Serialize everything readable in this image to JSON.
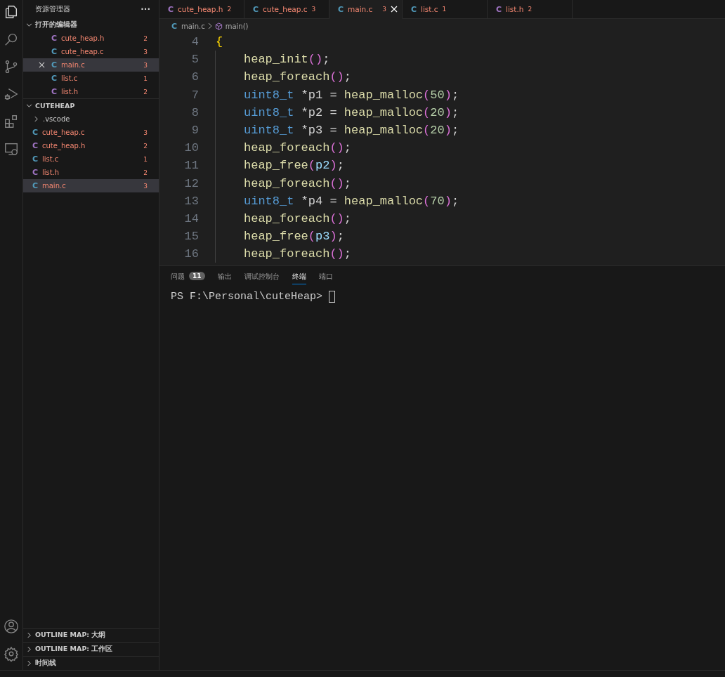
{
  "sidebar": {
    "title": "资源管理器",
    "more": "···",
    "open_editors": {
      "title": "打开的编辑器",
      "expanded": true,
      "items": [
        {
          "icon": "C",
          "kind": "header",
          "name": "cute_heap.h",
          "count": "2",
          "selected": false
        },
        {
          "icon": "C",
          "kind": "source",
          "name": "cute_heap.c",
          "count": "3",
          "selected": false
        },
        {
          "icon": "C",
          "kind": "source",
          "name": "main.c",
          "count": "3",
          "selected": true
        },
        {
          "icon": "C",
          "kind": "source",
          "name": "list.c",
          "count": "1",
          "selected": false
        },
        {
          "icon": "C",
          "kind": "header",
          "name": "list.h",
          "count": "2",
          "selected": false
        }
      ]
    },
    "folder": {
      "title": "CUTEHEAP",
      "expanded": true,
      "items": [
        {
          "kind": "folder",
          "name": ".vscode",
          "expanded": false,
          "selected": false
        },
        {
          "kind": "source",
          "icon": "C",
          "name": "cute_heap.c",
          "count": "3",
          "selected": false
        },
        {
          "kind": "header",
          "icon": "C",
          "name": "cute_heap.h",
          "count": "2",
          "selected": false
        },
        {
          "kind": "source",
          "icon": "C",
          "name": "list.c",
          "count": "1",
          "selected": false
        },
        {
          "kind": "header",
          "icon": "C",
          "name": "list.h",
          "count": "2",
          "selected": false
        },
        {
          "kind": "source",
          "icon": "C",
          "name": "main.c",
          "count": "3",
          "selected": true
        }
      ]
    },
    "bottom_sections": [
      {
        "title": "OUTLINE MAP: 大纲",
        "expanded": false
      },
      {
        "title": "OUTLINE MAP: 工作区",
        "expanded": false
      },
      {
        "title": "时间线",
        "expanded": false
      }
    ]
  },
  "tabs": [
    {
      "icon": "C",
      "kind": "header",
      "name": "cute_heap.h",
      "count": "2",
      "selected": false
    },
    {
      "icon": "C",
      "kind": "source",
      "name": "cute_heap.c",
      "count": "3",
      "selected": false
    },
    {
      "icon": "C",
      "kind": "source",
      "name": "main.c",
      "count": "3",
      "selected": true
    },
    {
      "icon": "C",
      "kind": "source",
      "name": "list.c",
      "count": "1",
      "selected": false
    },
    {
      "icon": "C",
      "kind": "header",
      "name": "list.h",
      "count": "2",
      "selected": false
    }
  ],
  "breadcrumb": {
    "icon": "C",
    "file": "main.c",
    "symbol": "main()"
  },
  "code": [
    {
      "number": "4",
      "indent": false,
      "tokens": [
        {
          "kind": "brace",
          "text": "{"
        }
      ]
    },
    {
      "number": "5",
      "indent": true,
      "tokens": [
        {
          "kind": "fn",
          "text": "heap_init"
        },
        {
          "kind": "paren",
          "text": "()"
        },
        {
          "kind": "plain",
          "text": ";"
        }
      ]
    },
    {
      "number": "6",
      "indent": true,
      "tokens": [
        {
          "kind": "fn",
          "text": "heap_foreach"
        },
        {
          "kind": "paren",
          "text": "()"
        },
        {
          "kind": "plain",
          "text": ";"
        }
      ]
    },
    {
      "number": "7",
      "indent": true,
      "tokens": [
        {
          "kind": "type",
          "text": "uint8_t"
        },
        {
          "kind": "plain",
          "text": " *p1 = "
        },
        {
          "kind": "fn",
          "text": "heap_malloc"
        },
        {
          "kind": "paren",
          "text": "("
        },
        {
          "kind": "num",
          "text": "50"
        },
        {
          "kind": "paren",
          "text": ")"
        },
        {
          "kind": "plain",
          "text": ";"
        }
      ]
    },
    {
      "number": "8",
      "indent": true,
      "tokens": [
        {
          "kind": "type",
          "text": "uint8_t"
        },
        {
          "kind": "plain",
          "text": " *p2 = "
        },
        {
          "kind": "fn",
          "text": "heap_malloc"
        },
        {
          "kind": "paren",
          "text": "("
        },
        {
          "kind": "num",
          "text": "20"
        },
        {
          "kind": "paren",
          "text": ")"
        },
        {
          "kind": "plain",
          "text": ";"
        }
      ]
    },
    {
      "number": "9",
      "indent": true,
      "tokens": [
        {
          "kind": "type",
          "text": "uint8_t"
        },
        {
          "kind": "plain",
          "text": " *p3 = "
        },
        {
          "kind": "fn",
          "text": "heap_malloc"
        },
        {
          "kind": "paren",
          "text": "("
        },
        {
          "kind": "num",
          "text": "20"
        },
        {
          "kind": "paren",
          "text": ")"
        },
        {
          "kind": "plain",
          "text": ";"
        }
      ]
    },
    {
      "number": "10",
      "indent": true,
      "tokens": [
        {
          "kind": "fn",
          "text": "heap_foreach"
        },
        {
          "kind": "paren",
          "text": "()"
        },
        {
          "kind": "plain",
          "text": ";"
        }
      ]
    },
    {
      "number": "11",
      "indent": true,
      "tokens": [
        {
          "kind": "fn",
          "text": "heap_free"
        },
        {
          "kind": "paren",
          "text": "("
        },
        {
          "kind": "var",
          "text": "p2"
        },
        {
          "kind": "paren",
          "text": ")"
        },
        {
          "kind": "plain",
          "text": ";"
        }
      ]
    },
    {
      "number": "12",
      "indent": true,
      "tokens": [
        {
          "kind": "fn",
          "text": "heap_foreach"
        },
        {
          "kind": "paren",
          "text": "()"
        },
        {
          "kind": "plain",
          "text": ";"
        }
      ]
    },
    {
      "number": "13",
      "indent": true,
      "tokens": [
        {
          "kind": "type",
          "text": "uint8_t"
        },
        {
          "kind": "plain",
          "text": " *p4 = "
        },
        {
          "kind": "fn",
          "text": "heap_malloc"
        },
        {
          "kind": "paren",
          "text": "("
        },
        {
          "kind": "num",
          "text": "70"
        },
        {
          "kind": "paren",
          "text": ")"
        },
        {
          "kind": "plain",
          "text": ";"
        }
      ]
    },
    {
      "number": "14",
      "indent": true,
      "tokens": [
        {
          "kind": "fn",
          "text": "heap_foreach"
        },
        {
          "kind": "paren",
          "text": "()"
        },
        {
          "kind": "plain",
          "text": ";"
        }
      ]
    },
    {
      "number": "15",
      "indent": true,
      "tokens": [
        {
          "kind": "fn",
          "text": "heap_free"
        },
        {
          "kind": "paren",
          "text": "("
        },
        {
          "kind": "var",
          "text": "p3"
        },
        {
          "kind": "paren",
          "text": ")"
        },
        {
          "kind": "plain",
          "text": ";"
        }
      ]
    },
    {
      "number": "16",
      "indent": true,
      "tokens": [
        {
          "kind": "fn",
          "text": "heap_foreach"
        },
        {
          "kind": "paren",
          "text": "()"
        },
        {
          "kind": "plain",
          "text": ";"
        }
      ]
    }
  ],
  "panel": {
    "tabs": [
      {
        "label": "问题",
        "badge": "11",
        "selected": false
      },
      {
        "label": "输出",
        "selected": false
      },
      {
        "label": "调试控制台",
        "selected": false
      },
      {
        "label": "终端",
        "selected": true
      },
      {
        "label": "端口",
        "selected": false
      }
    ],
    "terminal": {
      "prompt": "PS F:\\Personal\\cuteHeap>"
    }
  }
}
